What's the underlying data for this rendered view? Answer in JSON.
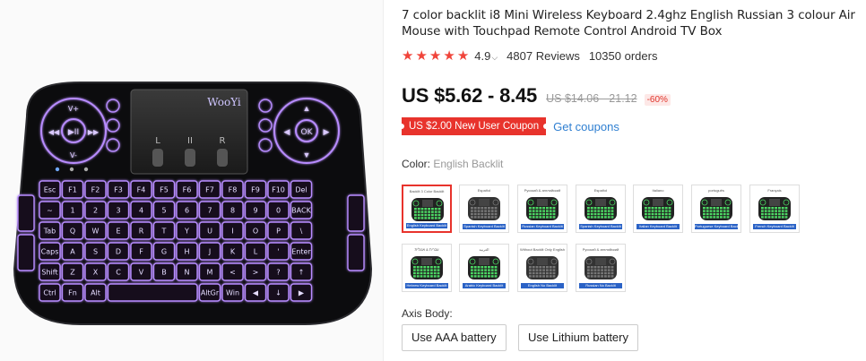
{
  "product": {
    "title": "7 color backlit i8 Mini Wireless Keyboard 2.4ghz English Russian 3 colour Air Mouse with Touchpad Remote Control Android TV Box",
    "rating": "4.9",
    "reviews": "4807 Reviews",
    "orders": "10350 orders",
    "star_count": 5,
    "price": "US $5.62 - 8.45",
    "price_original": "US $14.06 - 21.12",
    "discount": "-60%"
  },
  "coupon": {
    "label": "US $2.00 New User Coupon",
    "link": "Get coupons"
  },
  "color": {
    "label": "Color:",
    "selected": "English Backlit",
    "swatches": [
      {
        "caption": "Backlit 3 Color Backlit",
        "footer": "English Keyboard Backlit",
        "led": "green",
        "body": "#222"
      },
      {
        "caption": "Español",
        "footer": "Spanish Keyboard Backlit",
        "led": "none",
        "body": "#333"
      },
      {
        "caption": "Русский & английский",
        "footer": "Russian Keyboard Backlit",
        "led": "green",
        "body": "#222"
      },
      {
        "caption": "Español",
        "footer": "Spanish Keyboard Backlit",
        "led": "green",
        "body": "#222"
      },
      {
        "caption": "Italiano",
        "footer": "Italian Keyboard Backlit",
        "led": "green",
        "body": "#222"
      },
      {
        "caption": "português",
        "footer": "Portuguese Keyboard Backlit",
        "led": "green",
        "body": "#222"
      },
      {
        "caption": "Français",
        "footer": "French Keyboard Backlit",
        "led": "green",
        "body": "#222"
      },
      {
        "caption": "עברית & אנגלית",
        "footer": "Hebrew Keyboard Backlit",
        "led": "green",
        "body": "#222"
      },
      {
        "caption": "العربية",
        "footer": "Arabic Keyboard Backlit",
        "led": "green",
        "body": "#222"
      },
      {
        "caption": "Without Backlit Only English",
        "footer": "English No Backlit",
        "led": "none",
        "body": "#333"
      },
      {
        "caption": "Русский & английский",
        "footer": "Russian No Backlit",
        "led": "none",
        "body": "#333"
      }
    ]
  },
  "axis_body": {
    "label": "Axis Body:",
    "options": [
      "Use AAA battery",
      "Use Lithium battery"
    ]
  },
  "image": {
    "brand": "WooYi",
    "touchpad_buttons": [
      "L",
      "II",
      "R"
    ],
    "dpad_center": "OK"
  },
  "colors": {
    "accent_red": "#e8332c",
    "link_blue": "#2f7fd1",
    "key_glow": "#b88cff",
    "swatch_glow": "#4cd964"
  }
}
